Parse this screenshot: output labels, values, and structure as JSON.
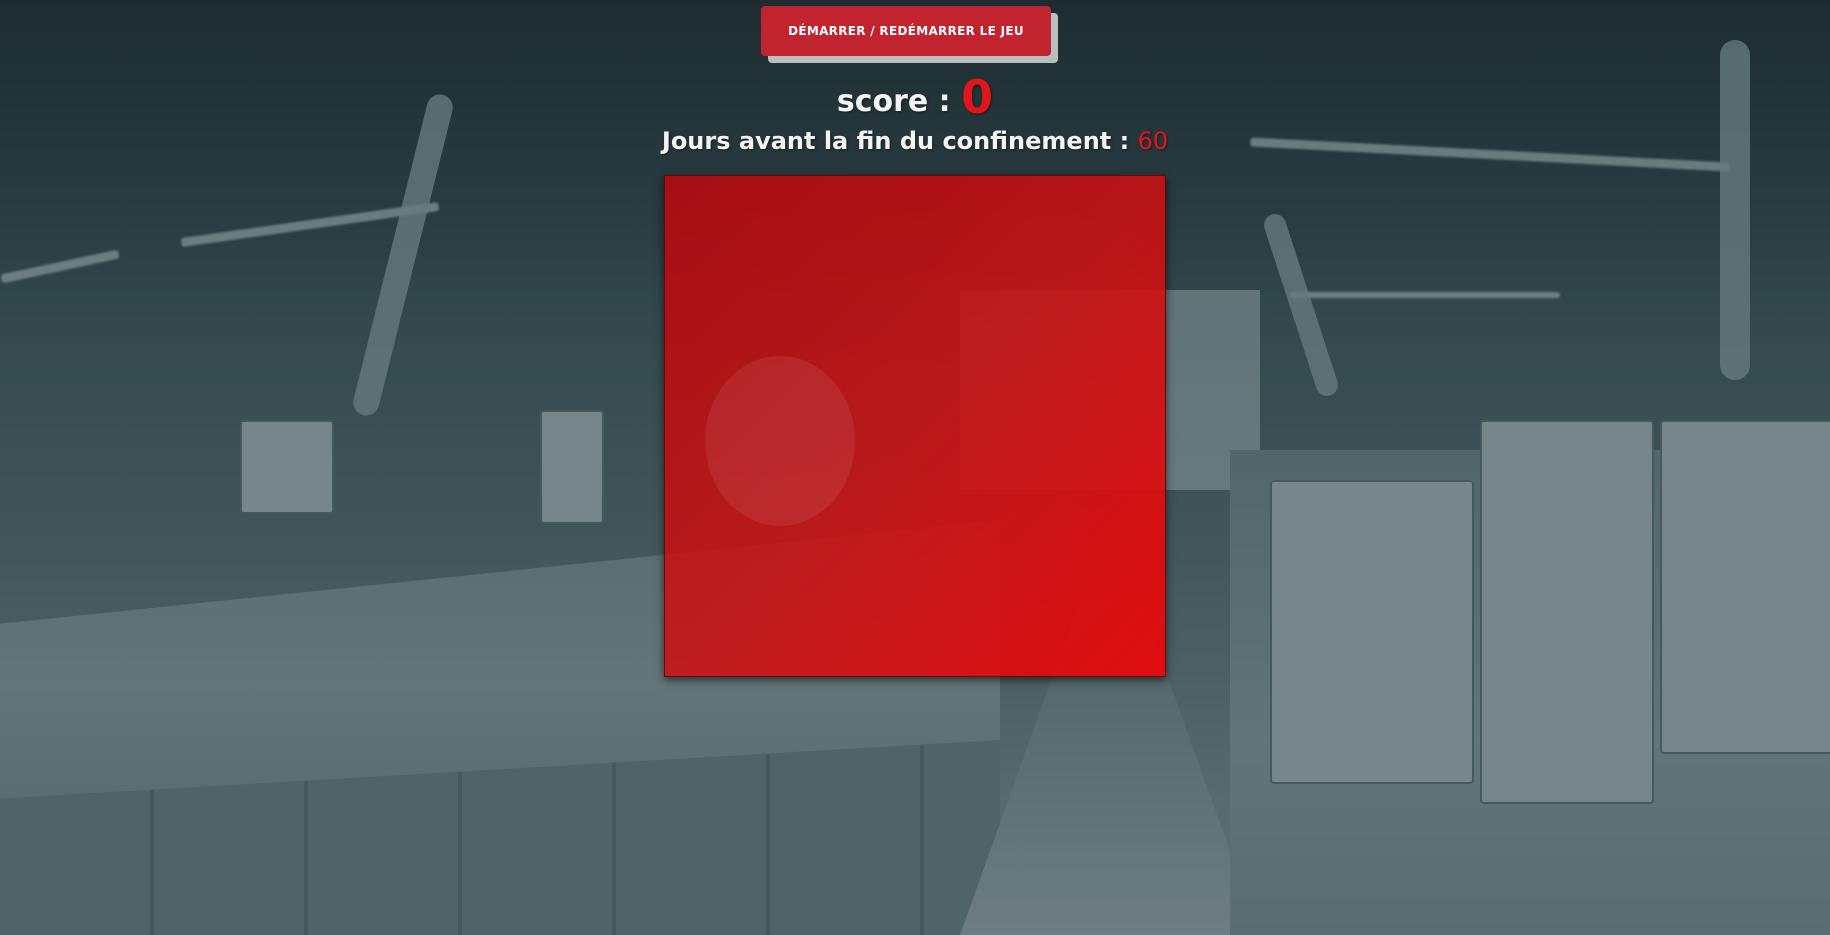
{
  "game": {
    "start_button_label": "DÉMARRER / REDÉMARRER LE JEU",
    "score_label": "score :",
    "score_value": "0",
    "days_label": "Jours avant la fin du confinement :",
    "days_value": "60"
  },
  "colors": {
    "accent_red": "#e0161c",
    "button_red": "#c2242f",
    "board_red": "#d40f14",
    "text_light": "#f3f3f3"
  }
}
